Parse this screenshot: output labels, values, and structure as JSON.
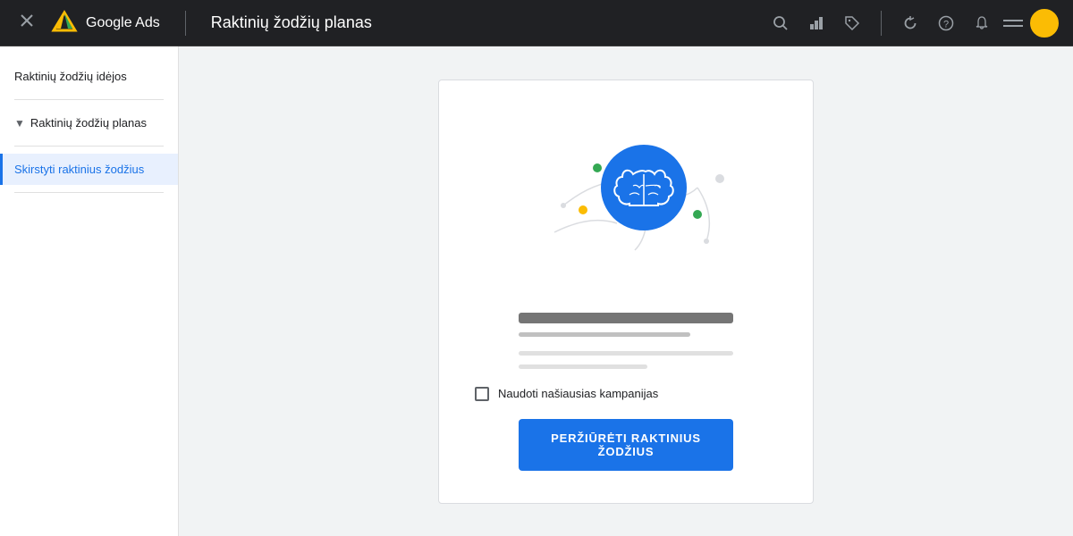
{
  "app": {
    "name": "Google Ads",
    "page_title": "Raktinių žodžių planas"
  },
  "topbar": {
    "close_label": "✕",
    "icons": {
      "search": "search-icon",
      "chart": "chart-icon",
      "tag": "tag-icon",
      "refresh": "refresh-icon",
      "help": "help-icon",
      "bell": "bell-icon"
    }
  },
  "sidebar": {
    "items": [
      {
        "label": "Raktinių žodžių idėjos",
        "active": false
      },
      {
        "label": "Raktinių žodžių planas",
        "active": false,
        "expandable": true
      },
      {
        "label": "Skirstyti raktinius žodžius",
        "active": true
      }
    ]
  },
  "card": {
    "checkbox_label": "Naudoti našiausias kampanijas",
    "cta_label": "PERŽIŪRĖTI RAKTINIUS ŽODŽIUS"
  },
  "colors": {
    "blue_brand": "#1a73e8",
    "topbar_bg": "#202124",
    "sidebar_active_bg": "#e8f0fe",
    "sidebar_active_text": "#1a73e8",
    "sidebar_active_border": "#1a73e8",
    "accent_yellow": "#fbbc04",
    "accent_green": "#34a853",
    "accent_orange": "#ea8600"
  }
}
